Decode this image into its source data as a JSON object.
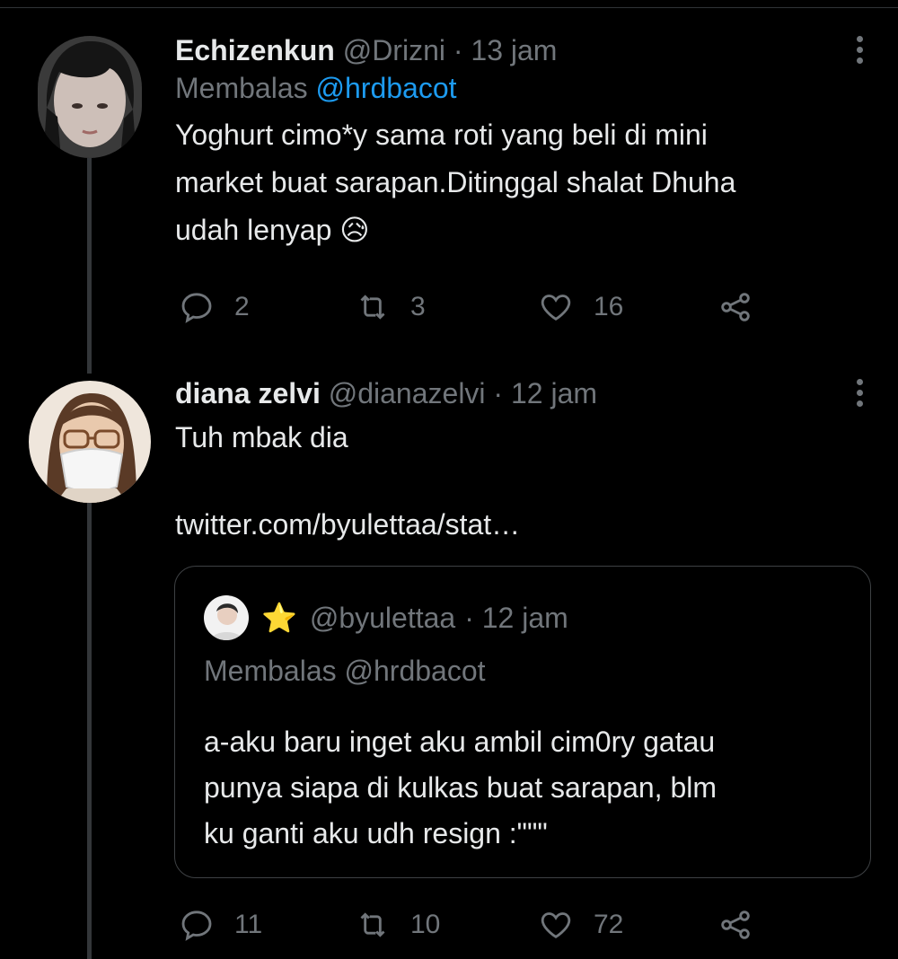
{
  "tweets": [
    {
      "name": "Echizenkun",
      "handle": "@Drizni",
      "time": "· 13 jam",
      "reply_prefix": "Membalas",
      "reply_handle": "@hrdbacot",
      "text_lines": [
        "Yoghurt cimo*y sama roti yang beli di mini",
        "market buat sarapan.Ditinggal shalat Dhuha",
        "udah lenyap 😥"
      ],
      "replies": "2",
      "retweets": "3",
      "likes": "16"
    },
    {
      "name": "diana zelvi",
      "handle": "@dianazelvi",
      "time": "· 12 jam",
      "text": "Tuh mbak dia",
      "link": "twitter.com/byulettaa/stat…",
      "quote": {
        "star": "⭐",
        "handle": "@byulettaa",
        "time": "· 12 jam",
        "reply_line": "Membalas @hrdbacot",
        "text_lines": [
          "a-aku baru inget aku ambil cim0ry gatau",
          "punya siapa di kulkas buat sarapan, blm",
          "ku ganti aku udh resign :\"\"\""
        ]
      },
      "replies": "11",
      "retweets": "10",
      "likes": "72"
    }
  ],
  "icons": {
    "reply": "reply-icon",
    "retweet": "retweet-icon",
    "like": "heart-icon",
    "share": "share-icon",
    "more": "more-icon"
  },
  "colors": {
    "background": "#000000",
    "text": "#e7e9ea",
    "muted": "#71767b",
    "link": "#1d9bf0",
    "border": "#3e4144"
  }
}
